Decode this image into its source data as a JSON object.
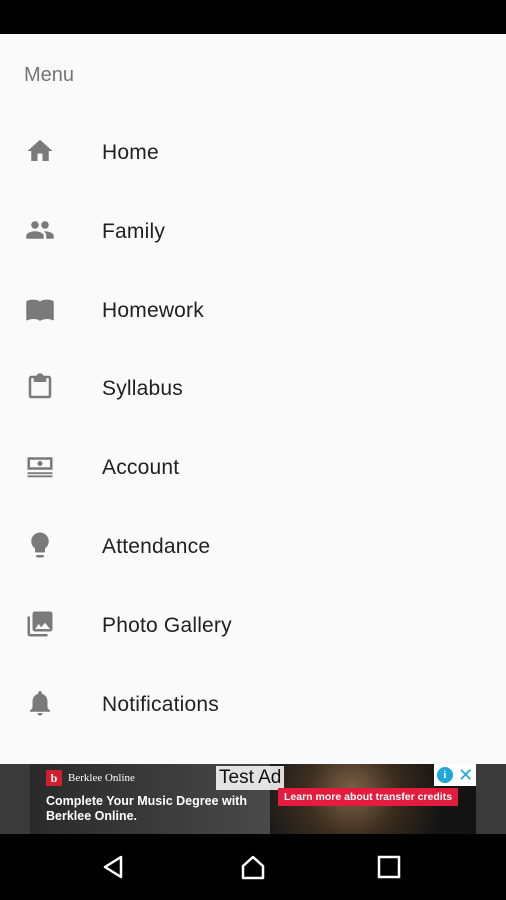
{
  "menu": {
    "header": "Menu",
    "items": [
      {
        "label": "Home",
        "icon": "home-icon"
      },
      {
        "label": "Family",
        "icon": "people-icon"
      },
      {
        "label": "Homework",
        "icon": "book-icon"
      },
      {
        "label": "Syllabus",
        "icon": "clipboard-icon"
      },
      {
        "label": "Account",
        "icon": "money-icon"
      },
      {
        "label": "Attendance",
        "icon": "lightbulb-icon"
      },
      {
        "label": "Photo Gallery",
        "icon": "photo-gallery-icon"
      },
      {
        "label": "Notifications",
        "icon": "bell-icon"
      }
    ]
  },
  "ad": {
    "brand": "Berklee Online",
    "brand_logo": "b",
    "headline": "Complete Your Music Degree with Berklee Online.",
    "test_label": "Test Ad",
    "cta": "Learn more about transfer credits",
    "info_glyph": "i",
    "close_glyph": "✕"
  },
  "nav": {
    "back": "back-icon",
    "home": "home-nav-icon",
    "recents": "recents-icon"
  },
  "colors": {
    "icon": "#7a7a7a",
    "text": "#212121",
    "header": "#757575",
    "cta": "#e31b3c",
    "ad_accent": "#1ea7d8"
  }
}
